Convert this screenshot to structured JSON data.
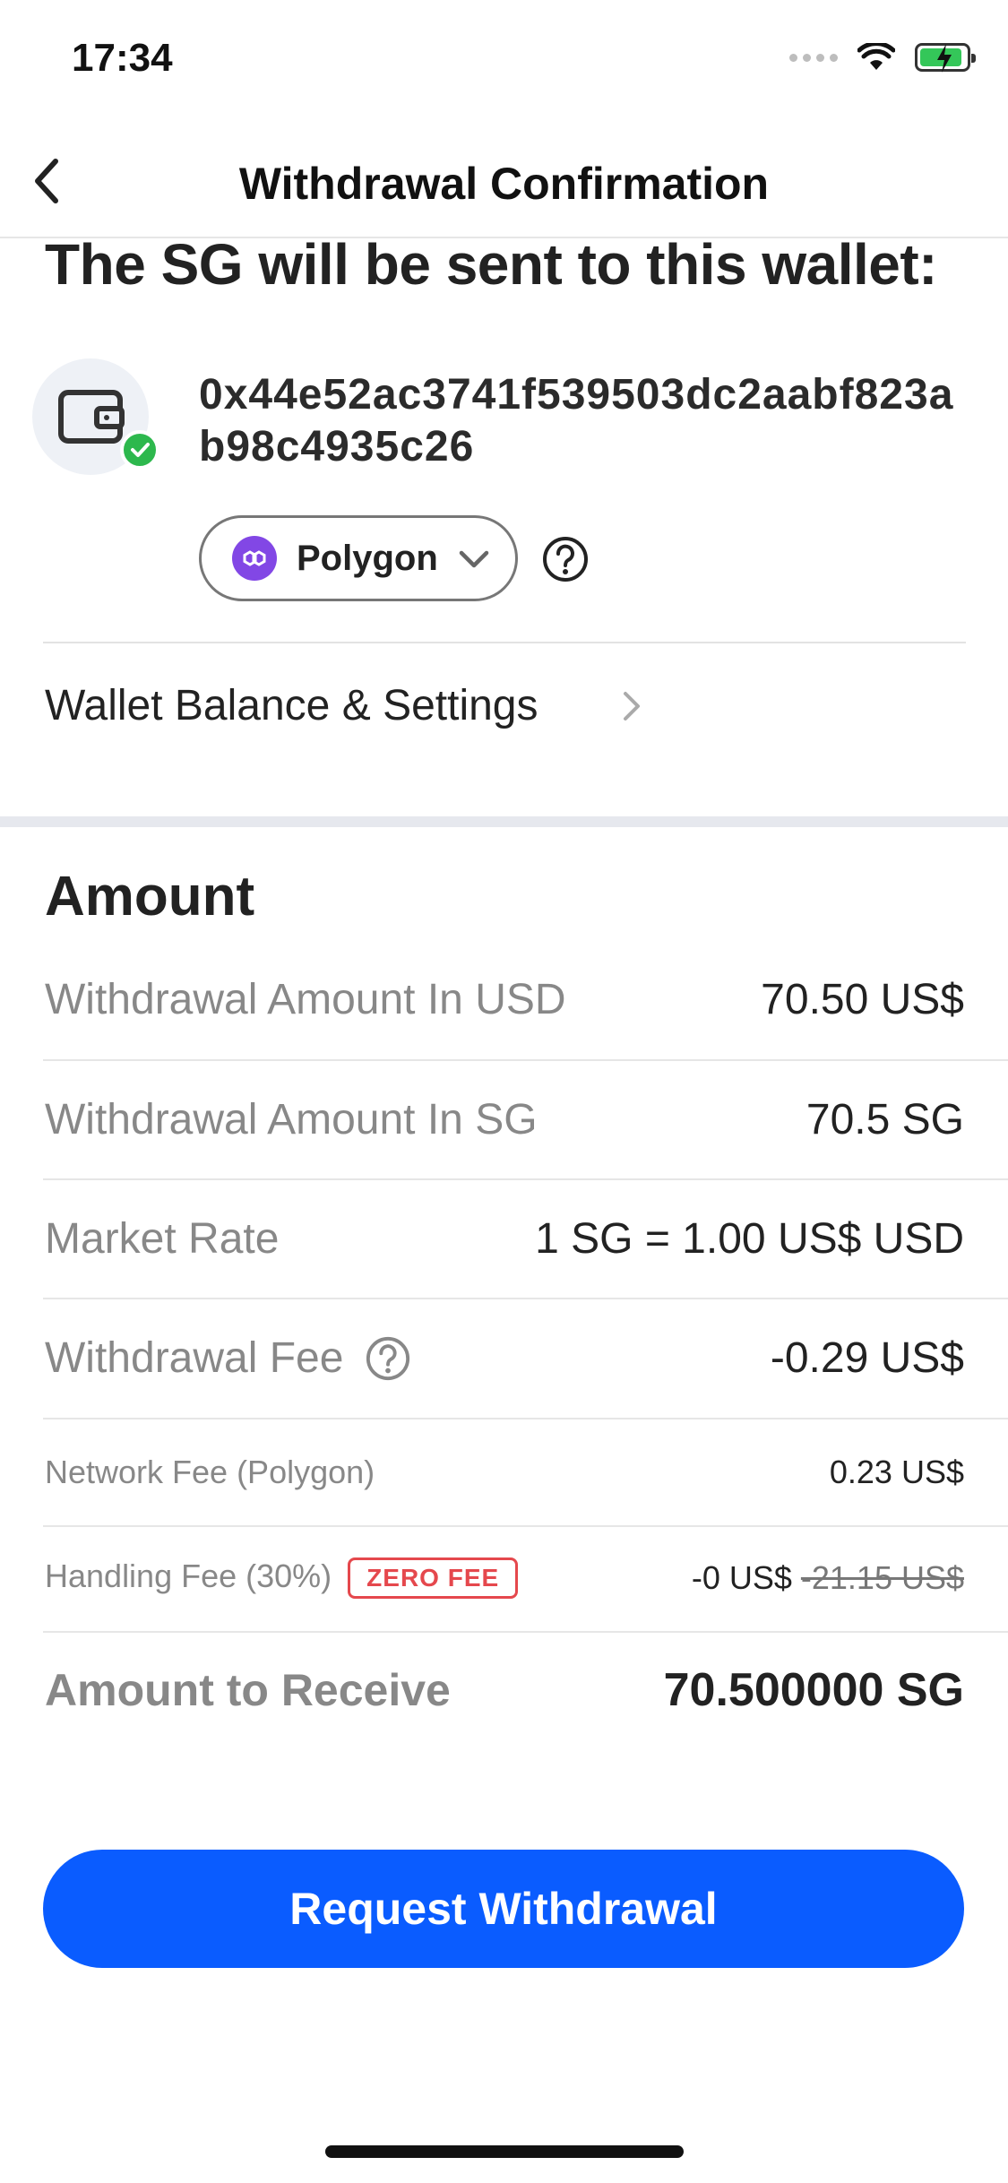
{
  "status_bar": {
    "time": "17:34"
  },
  "nav": {
    "title": "Withdrawal Confirmation"
  },
  "heading": "The SG will be sent to this wallet:",
  "wallet": {
    "address": "0x44e52ac3741f539503dc2aabf823ab98c4935c26",
    "network": "Polygon"
  },
  "settings_link": "Wallet Balance & Settings",
  "amount": {
    "title": "Amount",
    "rows": [
      {
        "label": "Withdrawal Amount In USD",
        "value": "70.50 US$"
      },
      {
        "label": "Withdrawal Amount In SG",
        "value": "70.5 SG"
      },
      {
        "label": "Market Rate",
        "value": "1 SG = 1.00 US$ USD"
      },
      {
        "label": "Withdrawal Fee",
        "value": "-0.29 US$"
      },
      {
        "label": "Network Fee (Polygon)",
        "value": "0.23 US$"
      },
      {
        "label": "Handling Fee (30%)",
        "badge": "ZERO FEE",
        "value": "-0 US$",
        "original_value": "-21.15 US$"
      }
    ],
    "receive_label": "Amount to Receive",
    "receive_value": "70.500000 SG"
  },
  "cta": "Request Withdrawal",
  "colors": {
    "primary": "#0a5cff",
    "polygon": "#8247e5",
    "verified": "#2db84d",
    "badge": "#e5484d"
  },
  "icons": [
    "back-chevron-icon",
    "wallet-icon",
    "verified-check-icon",
    "polygon-logo-icon",
    "chevron-down-icon",
    "help-icon",
    "chevron-right-icon",
    "wifi-icon",
    "battery-icon",
    "signal-icon"
  ]
}
